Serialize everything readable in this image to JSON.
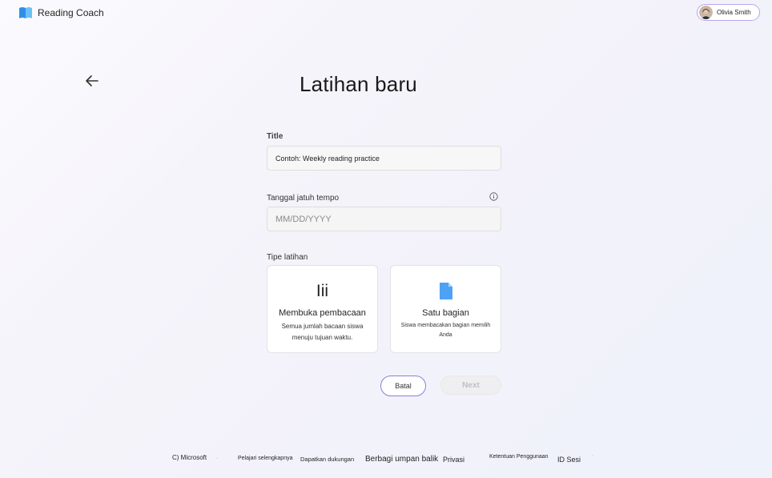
{
  "app": {
    "title": "Reading Coach"
  },
  "user": {
    "name": "Olivia Smith"
  },
  "page": {
    "title": "Latihan baru"
  },
  "form": {
    "title_label": "Title",
    "title_value": "Contoh: Weekly reading practice",
    "due_label": "Tanggal jatuh tempo",
    "due_placeholder": "MM/DD/YYYY",
    "type_label": "Tipe latihan"
  },
  "cards": [
    {
      "glyph": "Iii",
      "title": "Membuka pembacaan",
      "desc": "Semua jumlah bacaan siswa menuju tujuan waktu."
    },
    {
      "title": "Satu bagian",
      "desc": "Siswa membacakan bagian memilih Anda"
    }
  ],
  "actions": {
    "cancel": "Batal",
    "next": "Next"
  },
  "footer": {
    "copyright": "C) Microsoft",
    "learn_more": "Pelajari selengkapnya",
    "support": "Dapatkan dukungan",
    "feedback": "Berbagi umpan balik",
    "privacy": "Privasi",
    "terms": "Ketentuan Penggunaan",
    "session": "ID Sesi"
  },
  "colors": {
    "accent": "#8b7fd6",
    "logo_blue": "#3aa0f0",
    "file_blue": "#4ea2f5"
  }
}
